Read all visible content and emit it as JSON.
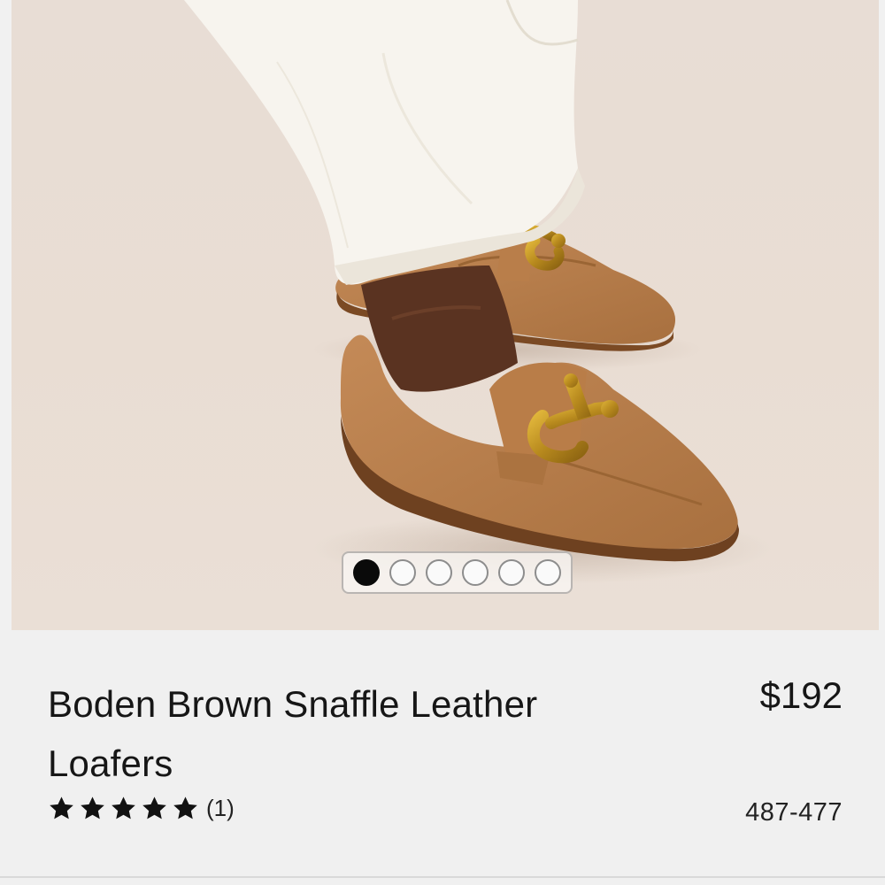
{
  "product": {
    "title": "Boden Brown Snaffle Leather Loafers",
    "price": "$192",
    "rating_value": 5,
    "rating_max": 5,
    "review_count_text": "(1)",
    "sku": "487-477"
  },
  "gallery": {
    "image_description": "tan suede loafers with gold snaffle bit hardware",
    "total_images": 6,
    "current_index": 0
  },
  "colors": {
    "background": "#f0f0f0",
    "active_dot": "#0a0a0a",
    "inactive_dot": "#fafafa",
    "star": "#111111"
  }
}
